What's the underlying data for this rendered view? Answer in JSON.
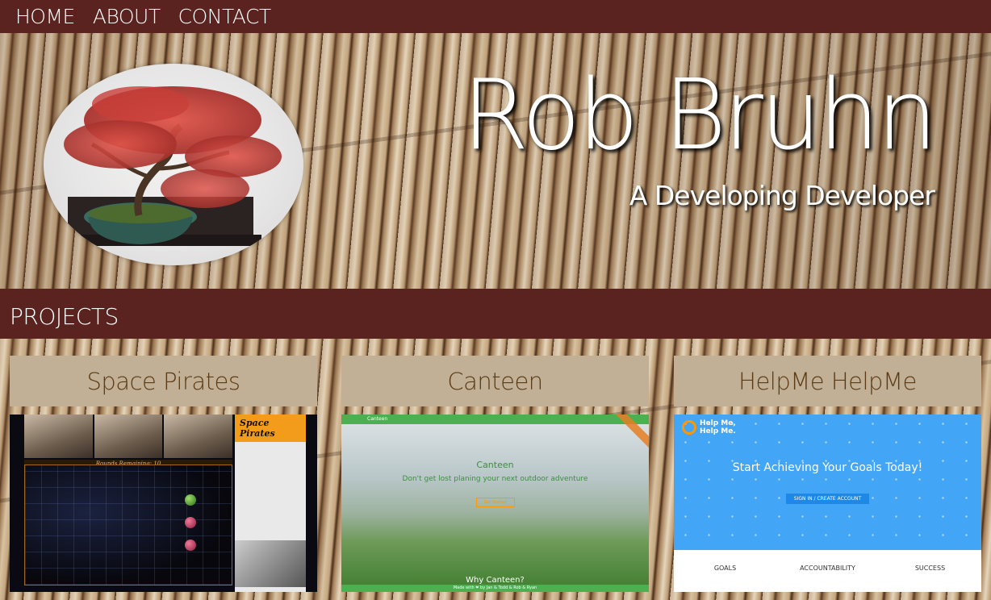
{
  "nav": {
    "items": [
      "HOME",
      "ABOUT",
      "CONTACT"
    ]
  },
  "hero": {
    "title": "Rob Bruhn",
    "subtitle": "A Developing Developer"
  },
  "projects": {
    "heading": "PROJECTS",
    "items": [
      {
        "title": "Space Pirates",
        "screenshot": {
          "app_title": "Space Pirates",
          "rounds_text": "Rounds Remaining: 10"
        }
      },
      {
        "title": "Canteen",
        "screenshot": {
          "nav_title": "Canteen",
          "headline": "Canteen",
          "tagline": "Don't get lost planing your next outdoor adventure",
          "button": "Get Started",
          "section": "Why Canteen?",
          "footer": "Made with ❤ by Jan & Todd & Rob & Ryan"
        }
      },
      {
        "title": "HelpMe HelpMe",
        "screenshot": {
          "logo_text": "Help Me, Help Me.",
          "headline": "Start Achieving Your Goals Today!",
          "button": "SIGN IN / CREATE ACCOUNT",
          "columns": [
            "GOALS",
            "ACCOUNTABILITY",
            "SUCCESS"
          ]
        }
      }
    ]
  },
  "colors": {
    "nav_bg": "#5a2320",
    "card_header": "#c2b096",
    "card_title": "#5a3b15"
  }
}
